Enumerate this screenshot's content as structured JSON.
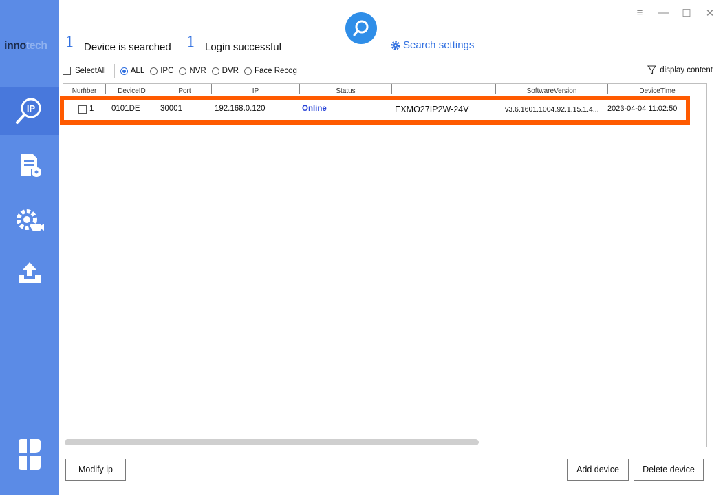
{
  "sidebar": {
    "brand_main": "inno",
    "brand_fade": "tech",
    "items": [
      {
        "name": "ip-search"
      },
      {
        "name": "document-settings"
      },
      {
        "name": "camera-settings"
      },
      {
        "name": "upgrade"
      }
    ]
  },
  "header": {
    "device_count": "1",
    "device_label": "Device is searched",
    "login_count": "1",
    "login_label": "Login successful",
    "search_settings": "Search settings",
    "window_controls": [
      "≡",
      "—",
      "☐",
      "✕"
    ]
  },
  "filter": {
    "select_all": "SelectAll",
    "types": [
      "ALL",
      "IPC",
      "NVR",
      "DVR",
      "Face Recog"
    ],
    "selected_type": "ALL",
    "display_content": "display content"
  },
  "table": {
    "columns": [
      "Number",
      "DeviceID",
      "Port",
      "IP",
      "Status",
      "",
      "SoftwareVersion",
      "DeviceTime"
    ],
    "rows": [
      {
        "number": "1",
        "device_id": "0101DE",
        "port": "30001",
        "ip": "192.168.0.120",
        "status": "Online",
        "model": "EXMO27IP2W-24V",
        "software_version": "v3.6.1601.1004.92.1.15.1.4...",
        "device_time": "2023-04-04 11:02:50"
      }
    ]
  },
  "buttons": {
    "modify_ip": "Modify ip",
    "add_device": "Add device",
    "delete_device": "Delete device"
  },
  "colors": {
    "sidebar": "#5b8be6",
    "accent": "#2f6fe0",
    "highlight": "#ff5a00",
    "online": "#2a45d8"
  }
}
